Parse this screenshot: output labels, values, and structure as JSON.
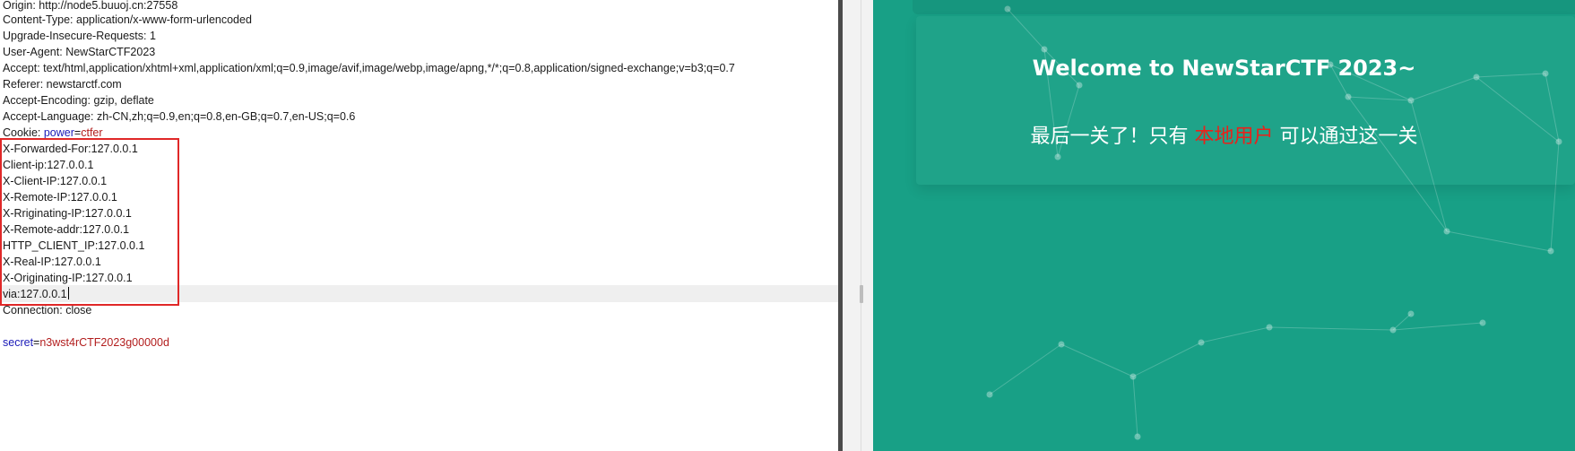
{
  "request_editor": {
    "lines": [
      {
        "name": "Origin",
        "sep": ": ",
        "value": "http://node5.buuoj.cn:27558"
      },
      {
        "name": "Content-Type",
        "sep": ": ",
        "value": "application/x-www-form-urlencoded"
      },
      {
        "name": "Upgrade-Insecure-Requests",
        "sep": ": ",
        "value": "1"
      },
      {
        "name": "User-Agent",
        "sep": ": ",
        "value": "NewStarCTF2023"
      },
      {
        "name": "Accept",
        "sep": ": ",
        "value": "text/html,application/xhtml+xml,application/xml;q=0.9,image/avif,image/webp,image/apng,*/*;q=0.8,application/signed-exchange;v=b3;q=0.7"
      },
      {
        "name": "Referer",
        "sep": ": ",
        "value": "newstarctf.com"
      },
      {
        "name": "Accept-Encoding",
        "sep": ": ",
        "value": "gzip, deflate"
      },
      {
        "name": "Accept-Language",
        "sep": ": ",
        "value": "zh-CN,zh;q=0.9,en;q=0.8,en-GB;q=0.7,en-US;q=0.6"
      },
      {
        "name": "X-Forwarded-For",
        "sep": ":",
        "value": "127.0.0.1"
      },
      {
        "name": "Client-ip",
        "sep": ":",
        "value": "127.0.0.1"
      },
      {
        "name": "X-Client-IP",
        "sep": ":",
        "value": "127.0.0.1"
      },
      {
        "name": "X-Remote-IP",
        "sep": ":",
        "value": "127.0.0.1"
      },
      {
        "name": "X-Rriginating-IP",
        "sep": ":",
        "value": "127.0.0.1"
      },
      {
        "name": "X-Remote-addr",
        "sep": ":",
        "value": "127.0.0.1"
      },
      {
        "name": "HTTP_CLIENT_IP",
        "sep": ":",
        "value": "127.0.0.1"
      },
      {
        "name": "X-Real-IP",
        "sep": ":",
        "value": "127.0.0.1"
      },
      {
        "name": "X-Originating-IP",
        "sep": ":",
        "value": "127.0.0.1"
      },
      {
        "name": "via",
        "sep": ":",
        "value": "127.0.0.1"
      },
      {
        "name": "Connection",
        "sep": ": ",
        "value": "close"
      }
    ],
    "cookie": {
      "label": "Cookie: ",
      "key": "power",
      "eq": "=",
      "value": "ctfer"
    },
    "body": {
      "key": "secret",
      "eq": "=",
      "value": "n3wst4rCTF2023g00000d"
    }
  },
  "page": {
    "title": "Welcome to NewStarCTF 2023~",
    "message_before": "最后一关了！只有 ",
    "message_highlight": "本地用户",
    "message_after": " 可以通过这一关"
  },
  "colors": {
    "page_background": "#18a086",
    "highlight_text": "#e8221b",
    "box_border": "#e02828",
    "param_name": "#1a1ab8",
    "param_value": "#b21d1d"
  }
}
